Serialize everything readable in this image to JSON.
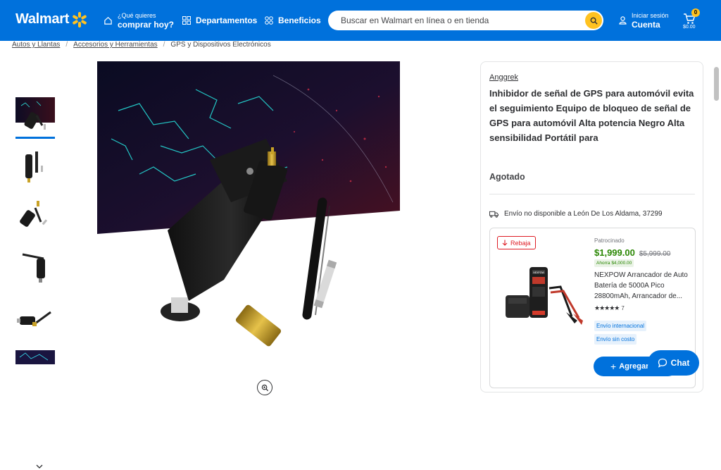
{
  "header": {
    "logo": "Walmart",
    "what_small": "¿Qué quieres",
    "what_big": "comprar hoy?",
    "departments": "Departamentos",
    "benefits": "Beneficios",
    "search_placeholder": "Buscar en Walmart en línea o en tienda",
    "signin_small": "Iniciar sesión",
    "signin_big": "Cuenta",
    "cart_count": "0",
    "cart_total": "$0.00",
    "brand_color": "#0071dc",
    "accent_color": "#ffc220"
  },
  "breadcrumb": [
    "Autos y Llantas",
    "Accesorios y Herramientas",
    "GPS y Dispositivos Electrónicos"
  ],
  "product": {
    "brand": "Anggrek",
    "title": "Inhibidor de señal de GPS para automóvil evita el seguimiento Equipo de bloqueo de señal de GPS para automóvil Alta potencia Negro Alta sensibilidad Portátil para",
    "stock": "Agotado",
    "shipping": "Envío no disponible a León De Los Aldama, 37299"
  },
  "sponsored": {
    "badge": "Rebaja",
    "label": "Patrocinado",
    "price": "$1,999.00",
    "old_price": "$5,999.00",
    "savings": "Ahorra $4,000.00",
    "description": "NEXPOW Arrancador de Auto Batería de 5000A Pico 28800mAh, Arrancador de...",
    "rating": 4.5,
    "reviews": "7",
    "tag1": "Envío internacional",
    "tag2": "Envío sin costo",
    "add_label": "Agregar",
    "image_brand_text": "NEXPOW"
  },
  "chat": {
    "label": "Chat"
  }
}
